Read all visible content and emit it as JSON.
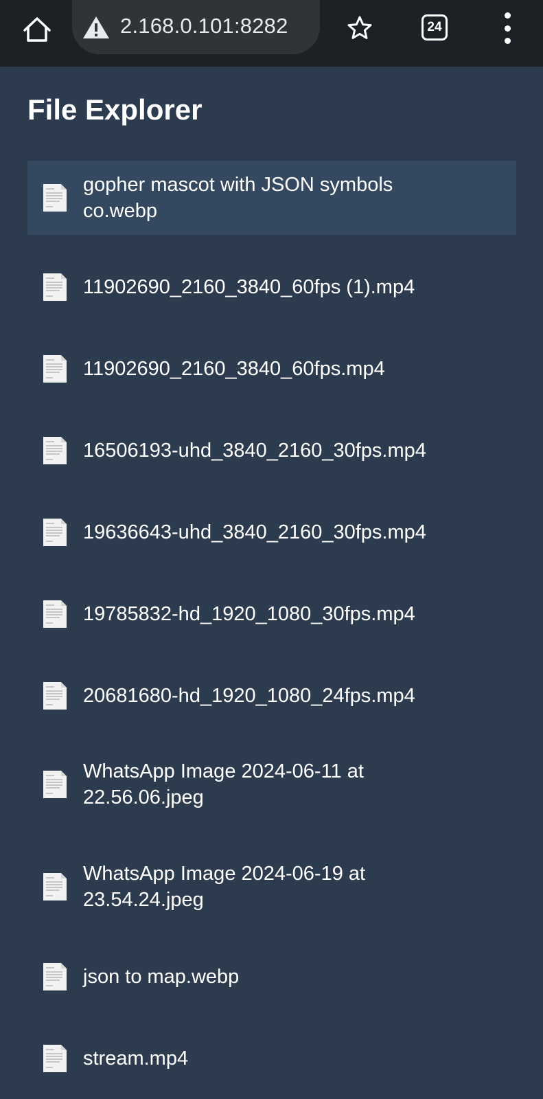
{
  "browser": {
    "url": "2.168.0.101:8282",
    "tab_count": "24"
  },
  "page": {
    "title": "File Explorer"
  },
  "files": [
    {
      "name": "gopher mascot with JSON symbols co.webp",
      "highlighted": true
    },
    {
      "name": "11902690_2160_3840_60fps (1).mp4"
    },
    {
      "name": "11902690_2160_3840_60fps.mp4"
    },
    {
      "name": "16506193-uhd_3840_2160_30fps.mp4"
    },
    {
      "name": "19636643-uhd_3840_2160_30fps.mp4"
    },
    {
      "name": "19785832-hd_1920_1080_30fps.mp4"
    },
    {
      "name": "20681680-hd_1920_1080_24fps.mp4"
    },
    {
      "name": "WhatsApp Image 2024-06-11 at 22.56.06.jpeg"
    },
    {
      "name": "WhatsApp Image 2024-06-19 at 23.54.24.jpeg"
    },
    {
      "name": "json to map.webp"
    },
    {
      "name": "stream.mp4"
    }
  ],
  "icons": {
    "home": "home-icon",
    "warning": "warning-icon",
    "star": "star-icon",
    "menu": "more-vert-icon",
    "file": "file-icon"
  },
  "colors": {
    "page_background": "#2d3b4e",
    "highlight_row": "#344860",
    "browser_bar": "#1d2126"
  }
}
